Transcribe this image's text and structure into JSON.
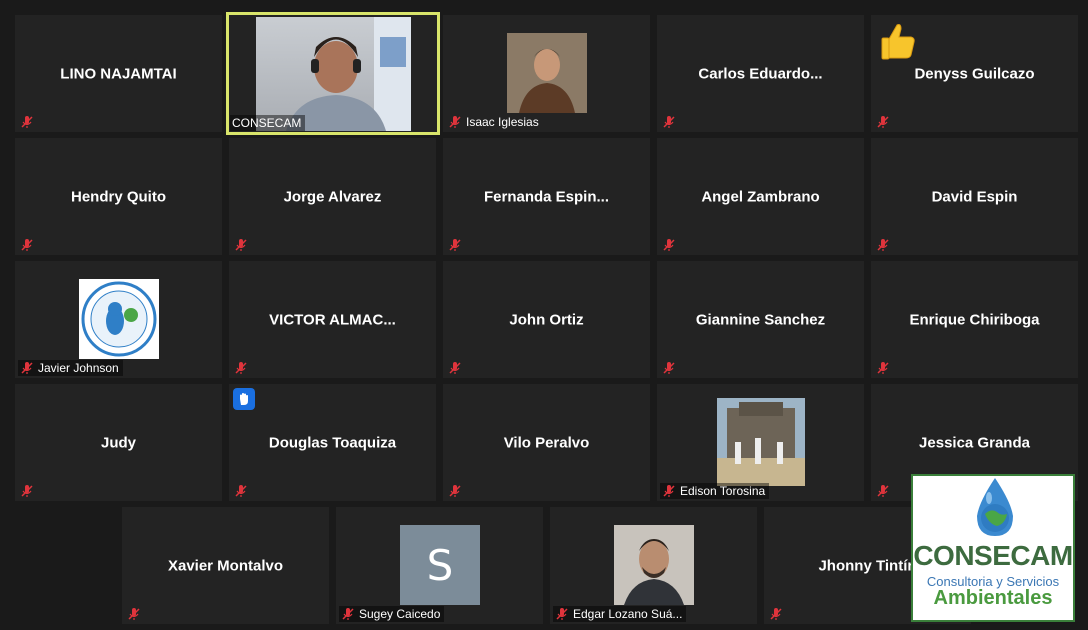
{
  "participants": [
    {
      "name": "LINO NAJAMTAI"
    },
    {
      "label": "CONSECAM"
    },
    {
      "label": "Isaac Iglesias"
    },
    {
      "name": "Carlos  Eduardo..."
    },
    {
      "name": "Denyss Guilcazo"
    },
    {
      "name": "Hendry Quito"
    },
    {
      "name": "Jorge Alvarez"
    },
    {
      "name": "Fernanda  Espin..."
    },
    {
      "name": "Angel  Zambrano"
    },
    {
      "name": "David Espin"
    },
    {
      "label": "Javier Johnson"
    },
    {
      "name": "VICTOR  ALMAC..."
    },
    {
      "name": "John Ortiz"
    },
    {
      "name": "Giannine Sanchez"
    },
    {
      "name": "Enrique Chiriboga"
    },
    {
      "name": "Judy"
    },
    {
      "name": "Douglas Toaquiza"
    },
    {
      "name": "Vilo Peralvo"
    },
    {
      "label": "Edison Torosina"
    },
    {
      "name": "Jessica Granda"
    },
    {
      "name": "Xavier Montalvo"
    },
    {
      "label": "Sugey Caicedo",
      "initial": "S"
    },
    {
      "label": "Edgar Lozano Suá..."
    },
    {
      "name": "Jhonny Tintín"
    }
  ],
  "overlay_logo": {
    "title": "CONSECAM",
    "subtitle": "Consultoria y Servicios",
    "subtitle2": "Ambientales"
  },
  "colors": {
    "active_speaker_border": "#d9e56b",
    "tile_bg": "#232323",
    "raise_hand": "#1a6fe0",
    "mic_muted": "#e0343c"
  }
}
